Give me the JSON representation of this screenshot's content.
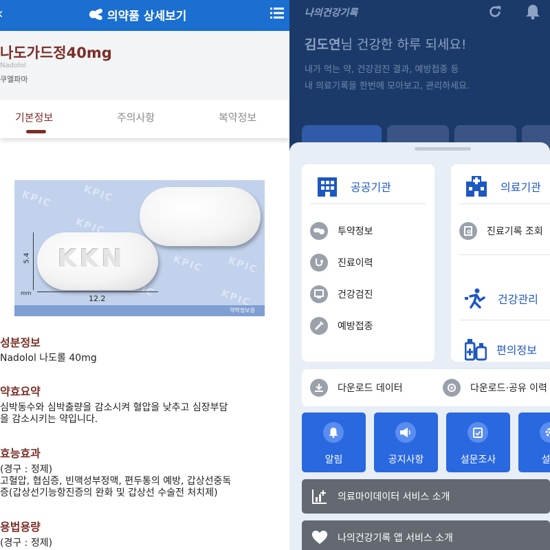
{
  "left": {
    "header": {
      "title": "의약품 상세보기"
    },
    "drug": {
      "name": "나도가드정40mg",
      "eng_name": "Nadolol",
      "maker": "쿠엘파마"
    },
    "tabs": [
      "기본정보",
      "주의사항",
      "복약정보"
    ],
    "active_tab": "기본정보",
    "image": {
      "imprint": "KKN",
      "height_label": "5.4",
      "unit_label": "mm",
      "width_label": "12.2",
      "watermark": "KPIC",
      "credit": "약학정보원"
    },
    "sections": [
      {
        "title": "성분정보",
        "lines": [
          "Nadolol 나도롤 40mg"
        ]
      },
      {
        "title": "약효요약",
        "lines": [
          "심박동수와 심박출량을 감소시켜 혈압을 낮추고 심장부담",
          "을 감소시키는 약입니다."
        ]
      },
      {
        "title": "효능효과",
        "lines": [
          "(경구 : 정제)",
          "고혈압, 협심증, 빈맥성부정맥, 편두통의 예방, 갑상선중독",
          "증(갑상선기능항진증의 완화 및 갑상선 수술전 처치제)"
        ]
      },
      {
        "title": "용법용량",
        "lines": [
          "(경구 : 정제)"
        ]
      }
    ]
  },
  "right": {
    "app_title": "나의건강기록",
    "greeting": {
      "name": "김도연",
      "suffix": "님 건강한 하루 되세요!"
    },
    "subtext": [
      "내가 먹는 약, 건강검진 결과, 예방접종 등",
      "내 의료기록을 한번에 모아보고, 관리하세요."
    ],
    "public_card": {
      "title": "공공기관",
      "items": [
        "투약정보",
        "진료이력",
        "건강검진",
        "예방접종"
      ]
    },
    "medical_card": {
      "title": "의료기관",
      "items": [
        "진료기록 조회"
      ],
      "big_items": [
        "건강관리",
        "편의정보"
      ]
    },
    "download_bar": {
      "left": "다운로드 데이터",
      "right": "다운로드·공유 이력"
    },
    "tiles": [
      "알림",
      "공지사항",
      "설문조사",
      "설정"
    ],
    "banners": [
      "의료마이데이터 서비스 소개",
      "나의건강기록 앱 서비스 소개"
    ],
    "colors": {
      "primary": "#2a68e0",
      "header_bg": "#1b3a69",
      "accent_text": "#1d57c2",
      "drug_title": "#7a2e28"
    }
  }
}
